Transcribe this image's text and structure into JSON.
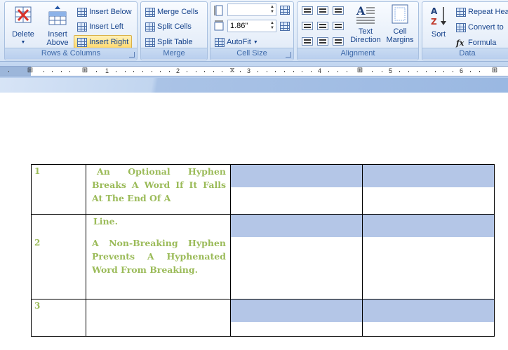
{
  "ribbon": {
    "rows_columns": {
      "label": "Rows & Columns",
      "delete": "Delete",
      "insert_above": [
        "Insert",
        "Above"
      ],
      "insert_below": "Insert Below",
      "insert_left": "Insert Left",
      "insert_right": "Insert Right"
    },
    "merge": {
      "label": "Merge",
      "merge_cells": "Merge Cells",
      "split_cells": "Split Cells",
      "split_table": "Split Table"
    },
    "cell_size": {
      "label": "Cell Size",
      "height_value": "",
      "width_value": "1.86\"",
      "autofit": "AutoFit"
    },
    "alignment": {
      "label": "Alignment",
      "text_direction": [
        "Text",
        "Direction"
      ],
      "cell_margins": [
        "Cell",
        "Margins"
      ]
    },
    "data": {
      "label": "Data",
      "sort": "Sort",
      "repeat_header": "Repeat Hea",
      "convert_to": "Convert to",
      "formula": "Formula"
    }
  },
  "ruler": {
    "numbers": [
      "1",
      "2",
      "3",
      "4",
      "5",
      "6"
    ]
  },
  "document": {
    "table": {
      "rows": [
        {
          "num": "1",
          "paragraphs": [
            "An Optional Hyphen Breaks A Word If It Falls At The End Of A"
          ]
        },
        {
          "num": "2",
          "paragraphs": [
            "Line.",
            "A Non-Breaking Hyphen Prevents A Hyphenated Word From Breaking."
          ]
        },
        {
          "num": "3",
          "paragraphs": []
        }
      ]
    }
  },
  "colors": {
    "table_text": "#9bbb59",
    "cell_shade": "#b4c6e7",
    "ribbon_text": "#15428b"
  }
}
